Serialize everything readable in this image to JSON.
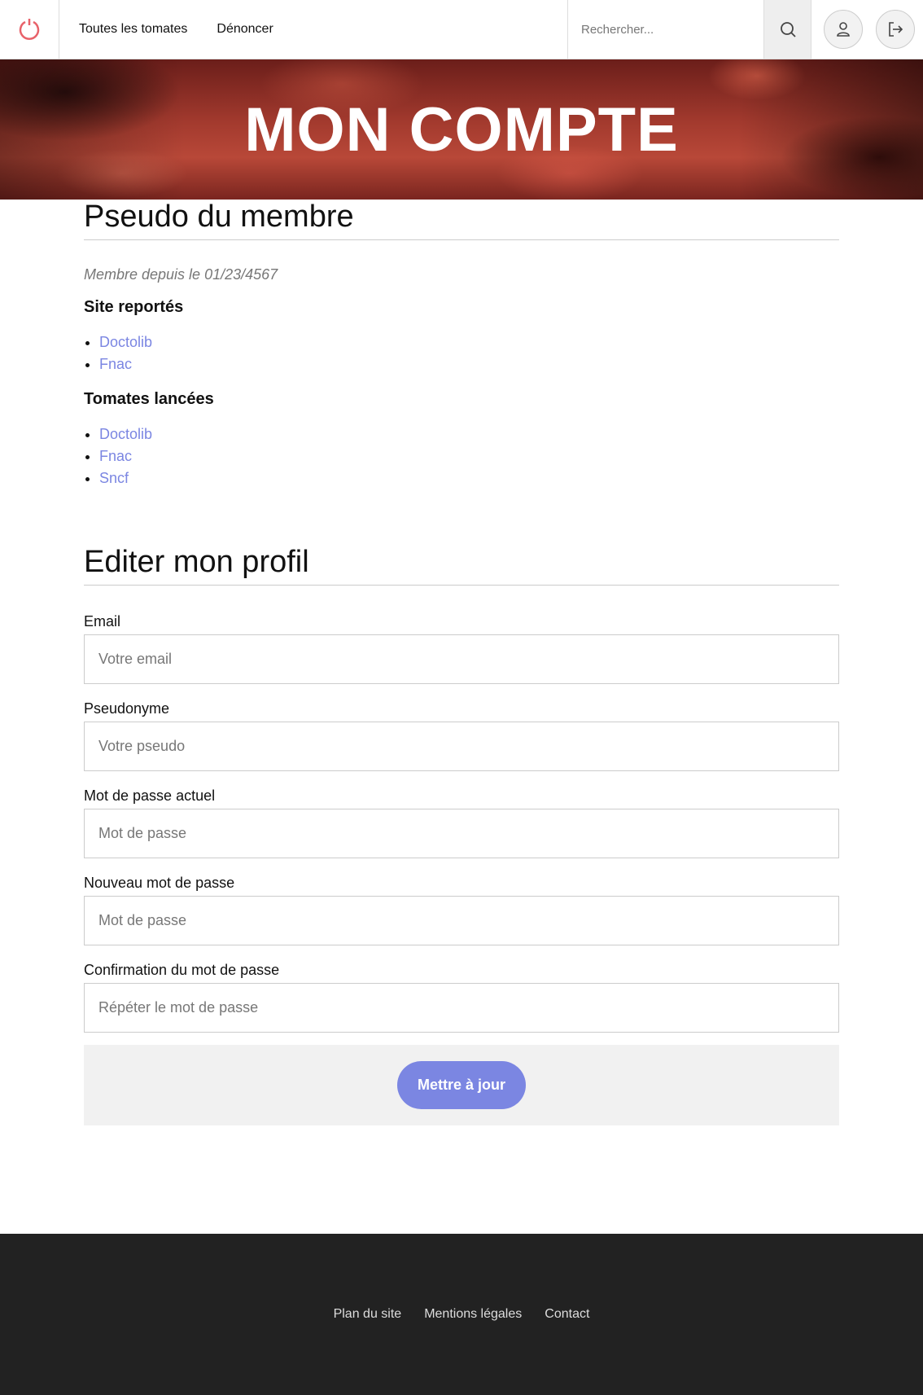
{
  "nav": {
    "links": [
      "Toutes les tomates",
      "Dénoncer"
    ],
    "search_placeholder": "Rechercher...",
    "icons": [
      "power-icon",
      "search-icon",
      "user-icon",
      "logout-icon"
    ]
  },
  "hero": {
    "title": "MON COMPTE"
  },
  "profile": {
    "pseudo": "Pseudo du membre",
    "member_since": "Membre depuis le 01/23/4567",
    "reported_title": "Site reportés",
    "reported_sites": [
      "Doctolib",
      "Fnac"
    ],
    "launched_title": "Tomates lancées",
    "launched_sites": [
      "Doctolib",
      "Fnac",
      "Sncf"
    ]
  },
  "form": {
    "title": "Editer mon profil",
    "email_label": "Email",
    "email_placeholder": "Votre email",
    "pseudo_label": "Pseudonyme",
    "pseudo_placeholder": "Votre pseudo",
    "current_password_label": "Mot de passe actuel",
    "current_password_placeholder": "Mot de passe",
    "new_password_label": "Nouveau mot de passe",
    "new_password_placeholder": "Mot de passe",
    "confirm_password_label": "Confirmation du mot de passe",
    "confirm_password_placeholder": "Répéter le mot de passe",
    "submit_label": "Mettre à jour"
  },
  "footer": {
    "links": [
      "Plan du site",
      "Mentions légales",
      "Contact"
    ]
  },
  "colors": {
    "accent": "#7b86e2",
    "logo": "#e8626a",
    "footer_bg": "#222222"
  }
}
